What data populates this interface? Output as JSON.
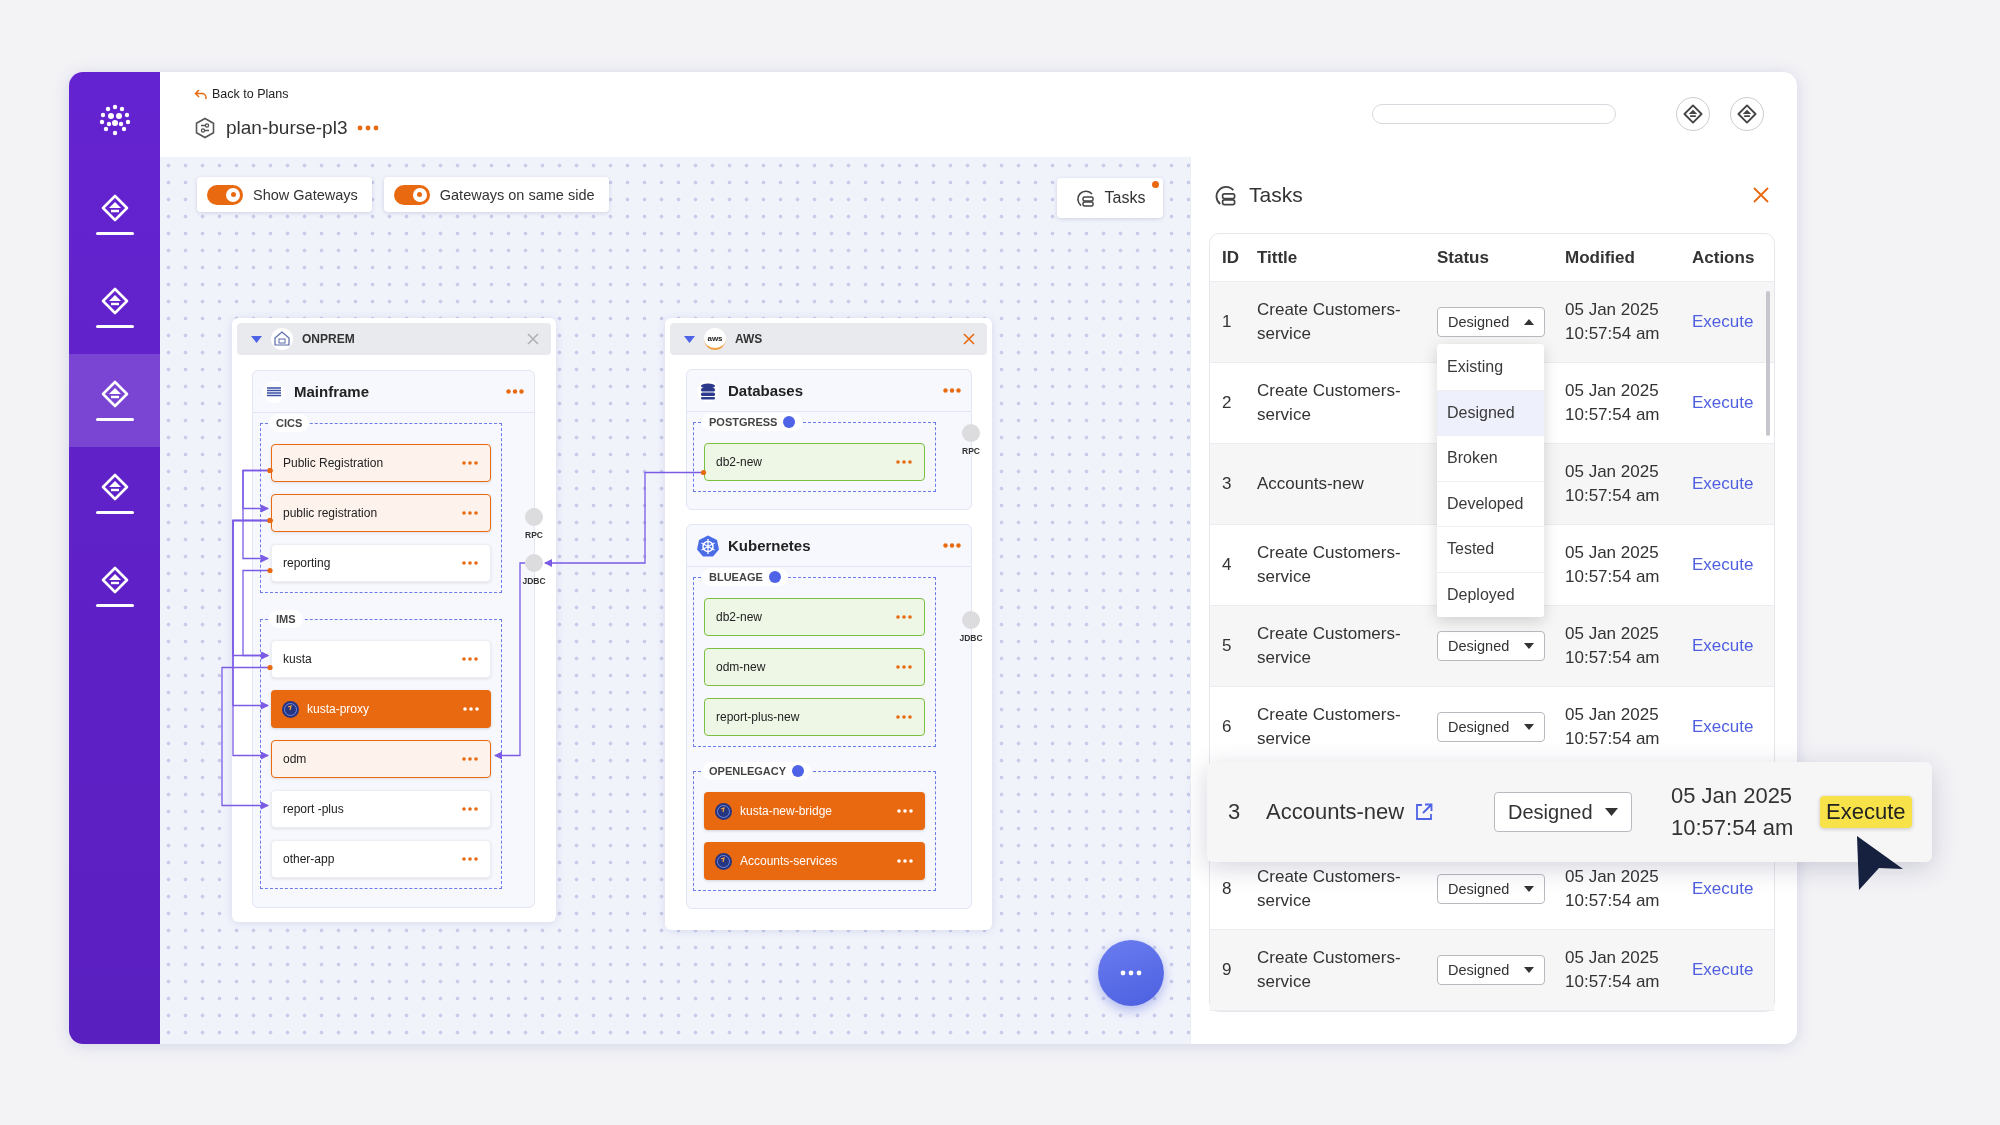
{
  "sidebar": {
    "items": [
      {
        "selected": false
      },
      {
        "selected": false
      },
      {
        "selected": true
      },
      {
        "selected": false
      },
      {
        "selected": false
      }
    ]
  },
  "header": {
    "back_link": "Back to Plans",
    "title": "plan-burse-pl3"
  },
  "canvas": {
    "toggles": [
      {
        "label": "Show Gateways",
        "on": true
      },
      {
        "label": "Gateways on same side",
        "on": true
      }
    ],
    "tasks_button": {
      "label": "Tasks",
      "has_notification": true
    },
    "groups": [
      {
        "name": "ONPREM",
        "kind": "onprem",
        "close_active": false,
        "gateways": [
          "RPC",
          "JDBC"
        ],
        "cards": [
          {
            "title": "Mainframe",
            "kind": "mainframe",
            "sections": [
              {
                "label": "CICS",
                "status_dot": false,
                "nodes": [
                  {
                    "label": "Public Registration",
                    "kind": "highlight"
                  },
                  {
                    "label": "public registration",
                    "kind": "highlight"
                  },
                  {
                    "label": "reporting",
                    "kind": "plain"
                  }
                ]
              },
              {
                "label": "IMS",
                "status_dot": false,
                "nodes": [
                  {
                    "label": "kusta",
                    "kind": "plain"
                  },
                  {
                    "label": "kusta-proxy",
                    "kind": "service"
                  },
                  {
                    "label": "odm",
                    "kind": "highlight"
                  },
                  {
                    "label": "report -plus",
                    "kind": "plain"
                  },
                  {
                    "label": "other-app",
                    "kind": "plain"
                  }
                ]
              }
            ]
          }
        ]
      },
      {
        "name": "AWS",
        "kind": "aws",
        "logo_text": "aws",
        "close_active": true,
        "gateways": [
          "RPC",
          "JDBC"
        ],
        "cards": [
          {
            "title": "Databases",
            "kind": "database",
            "sections": [
              {
                "label": "POSTGRESS",
                "status_dot": true,
                "nodes": [
                  {
                    "label": "db2-new",
                    "kind": "new"
                  }
                ]
              }
            ]
          },
          {
            "title": "Kubernetes",
            "kind": "kubernetes",
            "sections": [
              {
                "label": "BLUEAGE",
                "status_dot": true,
                "nodes": [
                  {
                    "label": "db2-new",
                    "kind": "new"
                  },
                  {
                    "label": "odm-new",
                    "kind": "new"
                  },
                  {
                    "label": "report-plus-new",
                    "kind": "new"
                  }
                ]
              },
              {
                "label": "OPENLEGACY",
                "status_dot": true,
                "nodes": [
                  {
                    "label": "kusta-new-bridge",
                    "kind": "service"
                  },
                  {
                    "label": "Accounts-services",
                    "kind": "service"
                  }
                ]
              }
            ]
          }
        ]
      }
    ]
  },
  "tasks": {
    "title": "Tasks",
    "columns": [
      "ID",
      "Tittle",
      "Status",
      "Modified",
      "Actions"
    ],
    "rows": [
      {
        "id": "1",
        "title": "Create Customers-service",
        "status": "Designed",
        "status_open": true,
        "modified": "05 Jan 2025 10:57:54 am",
        "action": "Execute"
      },
      {
        "id": "2",
        "title": "Create Customers-service",
        "modified": "05 Jan 2025 10:57:54 am",
        "action": "Execute"
      },
      {
        "id": "3",
        "title": "Accounts-new",
        "modified": "05 Jan 2025 10:57:54 am",
        "action": "Execute"
      },
      {
        "id": "4",
        "title": "Create Customers-service",
        "modified": "05 Jan 2025 10:57:54 am",
        "action": "Execute"
      },
      {
        "id": "5",
        "title": "Create Customers-service",
        "status": "Designed",
        "status_open": false,
        "modified": "05 Jan 2025 10:57:54 am",
        "action": "Execute"
      },
      {
        "id": "6",
        "title": "Create Customers-service",
        "status": "Designed",
        "status_open": false,
        "modified": "05 Jan 2025 10:57:54 am",
        "action": "Execute"
      },
      {
        "id": "8",
        "title": "Create Customers-service",
        "status": "Designed",
        "status_open": false,
        "modified": "05 Jan 2025 10:57:54 am",
        "action": "Execute"
      },
      {
        "id": "9",
        "title": "Create Customers-service",
        "status": "Designed",
        "status_open": false,
        "modified": "05 Jan 2025 10:57:54 am",
        "action": "Execute"
      }
    ],
    "status_menu": {
      "options": [
        {
          "label": "Existing",
          "selected": false
        },
        {
          "label": "Designed",
          "selected": true
        },
        {
          "label": "Broken",
          "selected": false
        },
        {
          "label": "Developed",
          "selected": false
        },
        {
          "label": "Tested",
          "selected": false
        },
        {
          "label": "Deployed",
          "selected": false
        }
      ]
    },
    "callout_row": {
      "id": "3",
      "title": "Accounts-new",
      "status": "Designed",
      "modified": "05 Jan 2025 10:57:54 am",
      "action": "Execute",
      "action_highlighted": true
    }
  }
}
